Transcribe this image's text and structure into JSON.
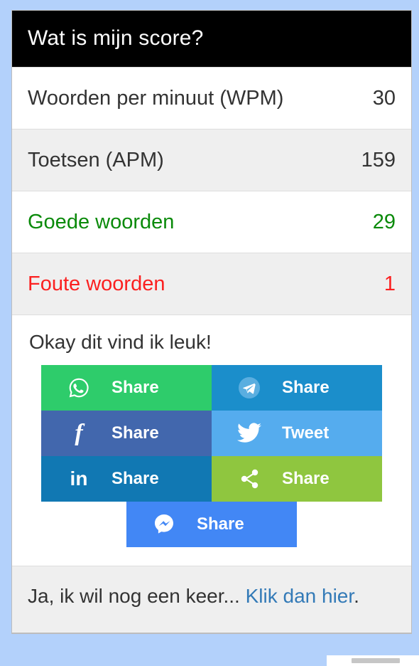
{
  "header": {
    "title": "Wat is mijn score?"
  },
  "stats": [
    {
      "label": "Woorden per minuut (WPM)",
      "value": "30",
      "style": "plain",
      "striped": false
    },
    {
      "label": "Toetsen (APM)",
      "value": "159",
      "style": "plain",
      "striped": true
    },
    {
      "label": "Goede woorden",
      "value": "29",
      "style": "success",
      "striped": false
    },
    {
      "label": "Foute woorden",
      "value": "1",
      "style": "danger",
      "striped": true
    }
  ],
  "share": {
    "prompt": "Okay dit vind ik leuk!",
    "buttons": [
      {
        "network": "whatsapp",
        "icon": "whatsapp-icon",
        "label": "Share",
        "color": "#2ecc6b"
      },
      {
        "network": "telegram",
        "icon": "telegram-icon",
        "label": "Share",
        "color": "#1b8ecb"
      },
      {
        "network": "facebook",
        "icon": "facebook-icon",
        "label": "Share",
        "color": "#4267ad"
      },
      {
        "network": "twitter",
        "icon": "twitter-icon",
        "label": "Tweet",
        "color": "#55acee"
      },
      {
        "network": "linkedin",
        "icon": "linkedin-icon",
        "label": "Share",
        "color": "#1178b3"
      },
      {
        "network": "generic",
        "icon": "share-nodes-icon",
        "label": "Share",
        "color": "#8fc63f"
      },
      {
        "network": "messenger",
        "icon": "messenger-icon",
        "label": "Share",
        "color": "#4287f5"
      }
    ]
  },
  "footer": {
    "text": "Ja, ik wil nog een keer...",
    "link_text": "Klik dan hier",
    "trailing": "."
  },
  "colors": {
    "page_background": "#b3d1fb",
    "header_background": "#000000",
    "success_text": "#0a8a0a",
    "danger_text": "#fb2020",
    "link": "#337ab7"
  }
}
